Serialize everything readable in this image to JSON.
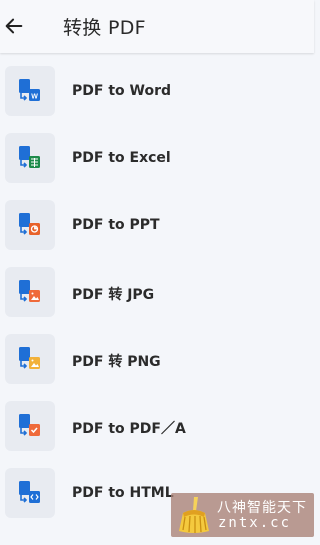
{
  "header": {
    "title": "转换 PDF",
    "back_icon": "arrow-left-icon"
  },
  "items": [
    {
      "label": "PDF to Word",
      "icon": "pdf-to-word-icon",
      "badge_color": "#1f6fd6",
      "badge_glyph": "W"
    },
    {
      "label": "PDF to Excel",
      "icon": "pdf-to-excel-icon",
      "badge_color": "#1d8a4a",
      "badge_glyph": "grid"
    },
    {
      "label": "PDF to PPT",
      "icon": "pdf-to-ppt-icon",
      "badge_color": "#e8622a",
      "badge_glyph": "pie"
    },
    {
      "label": "PDF 转 JPG",
      "icon": "pdf-to-jpg-icon",
      "badge_color": "#ef6a3a",
      "badge_glyph": "image"
    },
    {
      "label": "PDF 转 PNG",
      "icon": "pdf-to-png-icon",
      "badge_color": "#f2b13a",
      "badge_glyph": "image"
    },
    {
      "label": "PDF to PDF／A",
      "icon": "pdf-to-pdfa-icon",
      "badge_color": "#ef6a3a",
      "badge_glyph": "check"
    },
    {
      "label": "PDF to HTML",
      "icon": "pdf-to-html-icon",
      "badge_color": "#1f6fd6",
      "badge_glyph": "code"
    }
  ],
  "watermark": {
    "line1": "八神智能天下",
    "line2": "zntx.cc"
  },
  "colors": {
    "background": "#f4f6fa",
    "tile": "#e8ebf1",
    "doc_blue": "#1f6fd6"
  }
}
